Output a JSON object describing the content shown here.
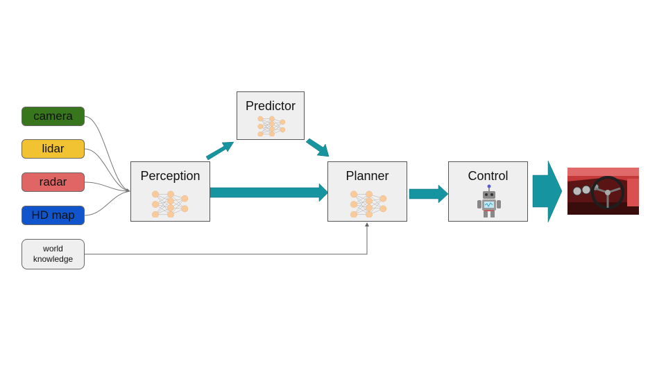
{
  "inputs": [
    {
      "label": "camera",
      "color": "#38761d"
    },
    {
      "label": "lidar",
      "color": "#f1c232"
    },
    {
      "label": "radar",
      "color": "#e06666"
    },
    {
      "label": "HD map",
      "color": "#1155cc"
    },
    {
      "label": "world\nknowledge",
      "color": "#efefef"
    }
  ],
  "modules": {
    "perception": {
      "title": "Perception",
      "icon": "neural-network"
    },
    "predictor": {
      "title": "Predictor",
      "icon": "neural-network"
    },
    "planner": {
      "title": "Planner",
      "icon": "neural-network"
    },
    "control": {
      "title": "Control",
      "icon": "robot"
    }
  },
  "output": {
    "image": "car-dashboard-steering-wheel"
  },
  "colors": {
    "arrow": "#16949f",
    "box_fill": "#efefef",
    "connector": "#666666"
  }
}
